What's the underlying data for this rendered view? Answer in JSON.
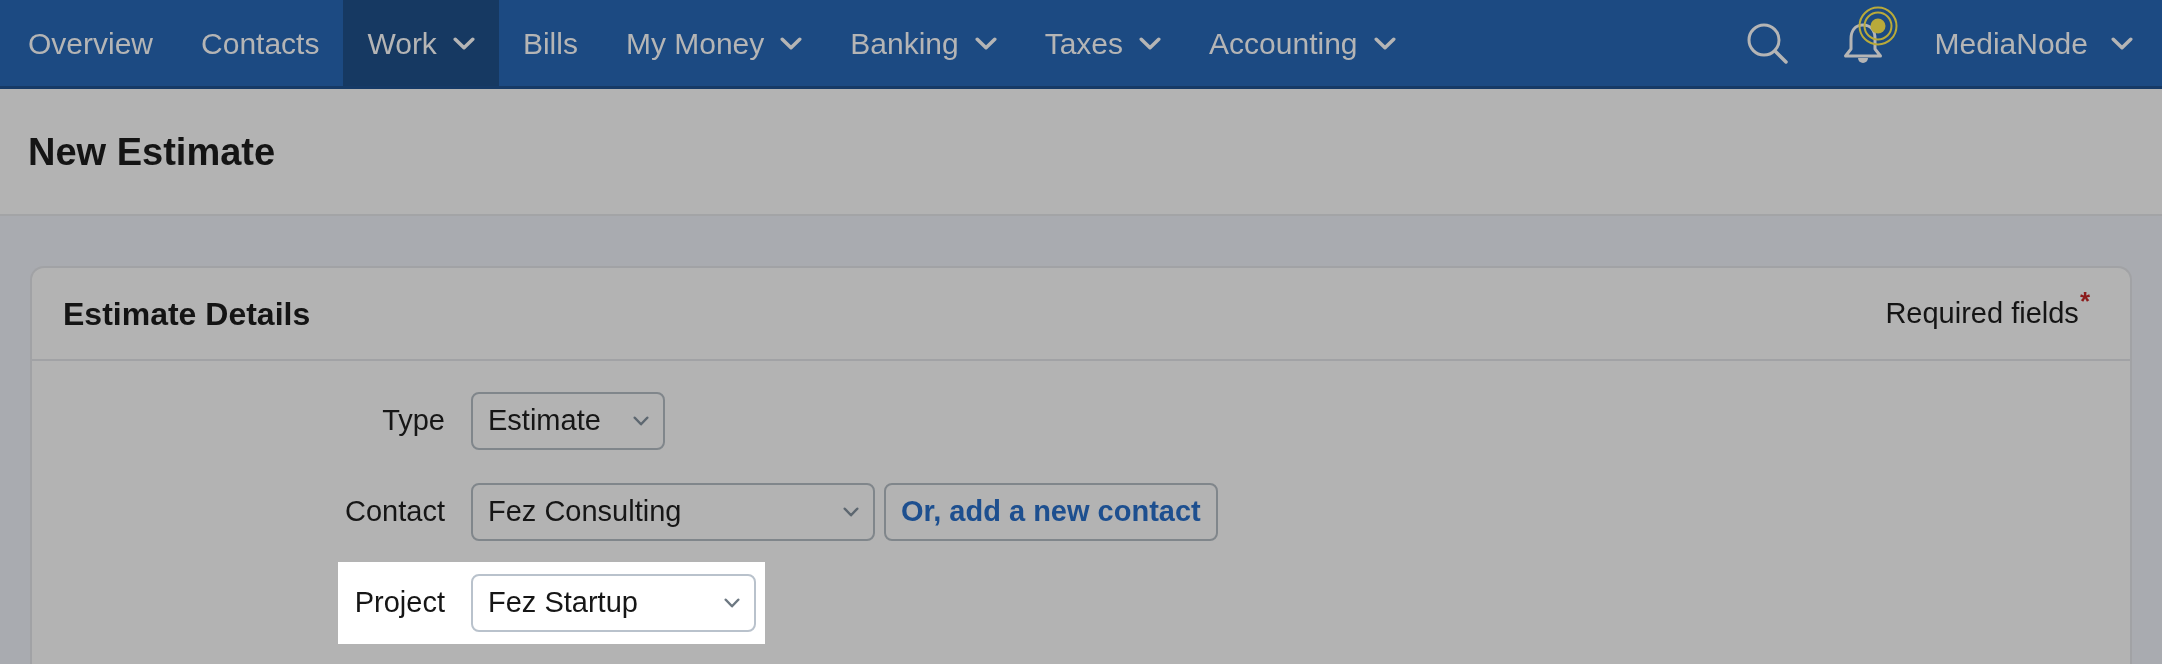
{
  "nav": {
    "items": [
      {
        "label": "Overview",
        "dropdown": false,
        "selected": false
      },
      {
        "label": "Contacts",
        "dropdown": false,
        "selected": false
      },
      {
        "label": "Work",
        "dropdown": true,
        "selected": true
      },
      {
        "label": "Bills",
        "dropdown": false,
        "selected": false
      },
      {
        "label": "My Money",
        "dropdown": true,
        "selected": false
      },
      {
        "label": "Banking",
        "dropdown": true,
        "selected": false
      },
      {
        "label": "Taxes",
        "dropdown": true,
        "selected": false
      },
      {
        "label": "Accounting",
        "dropdown": true,
        "selected": false
      }
    ],
    "notifications": {
      "unread": true
    },
    "account": {
      "label": "MediaNode"
    }
  },
  "page": {
    "title": "New Estimate"
  },
  "card": {
    "title": "Estimate Details",
    "required_note": "Required fields$^{*}$"
  },
  "form": {
    "fields": [
      {
        "label": "Type",
        "value": "Estimate",
        "highlighted": false
      },
      {
        "label": "Contact",
        "value": "Fez Consulting",
        "highlighted": false,
        "action": "Or, add a new contact"
      },
      {
        "label": "Project",
        "value": "Fez Startup",
        "highlighted": true
      }
    ]
  }
}
